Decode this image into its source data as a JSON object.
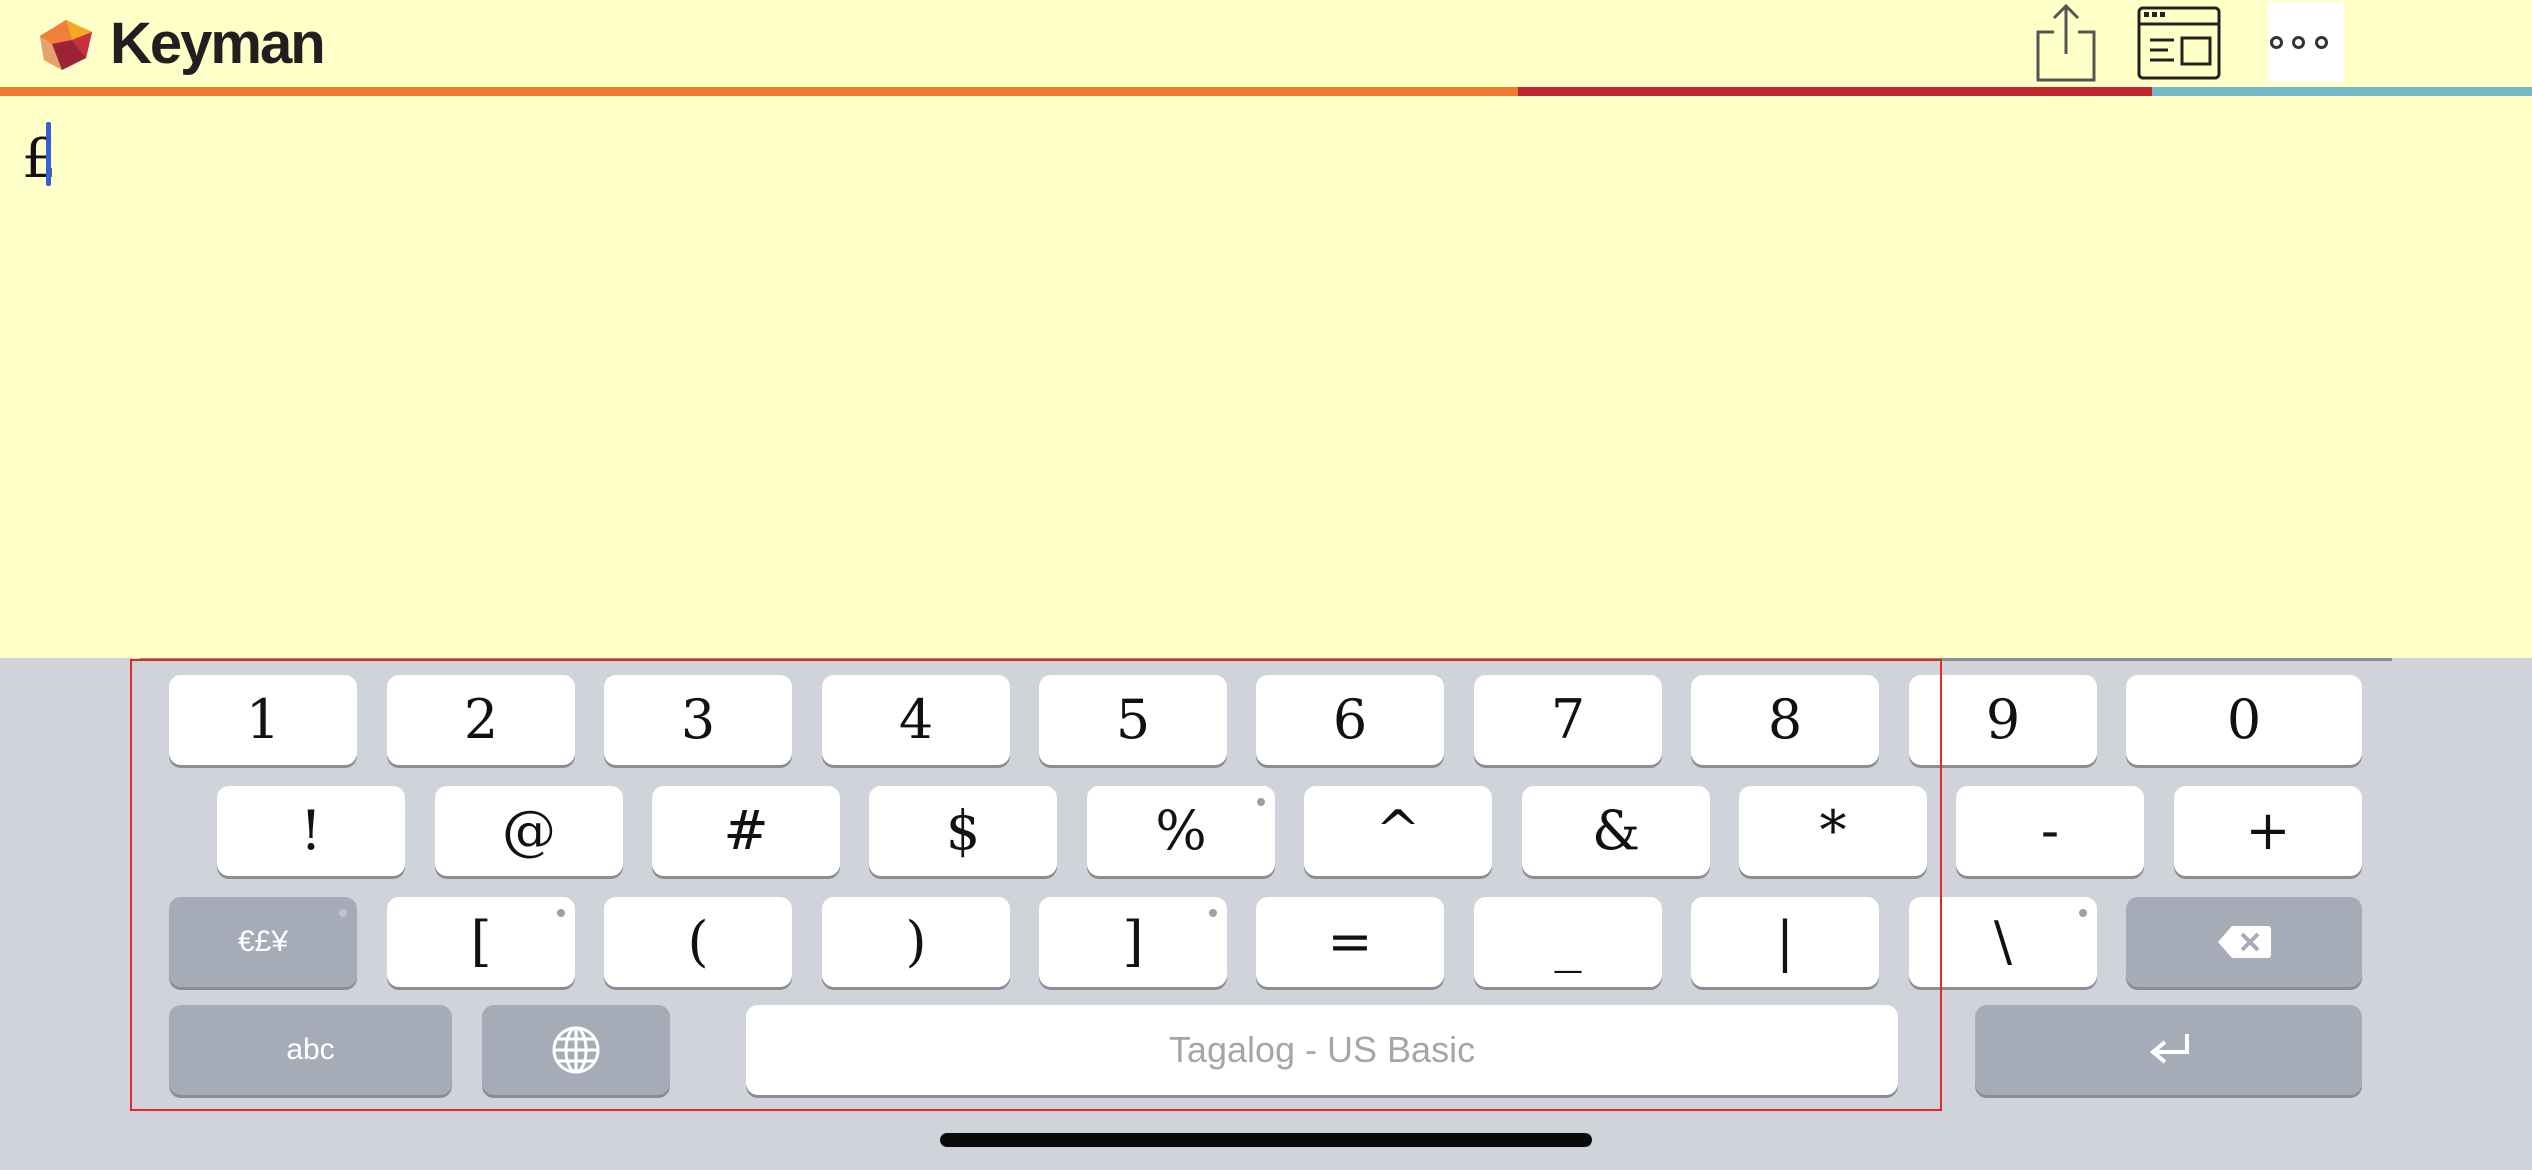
{
  "app": {
    "brand": "Keyman"
  },
  "toolbar": {
    "share_icon": "share-icon",
    "keyboard_picker_icon": "keyboard-picker-icon",
    "more_icon": "more-icon"
  },
  "stripe_colors": {
    "orange": "#ef7a31",
    "red": "#c0262d",
    "teal": "#74b9c8"
  },
  "editor": {
    "text": "£"
  },
  "keyboard": {
    "name": "Tagalog - US Basic",
    "row1": [
      "1",
      "2",
      "3",
      "4",
      "5",
      "6",
      "7",
      "8",
      "9",
      "0"
    ],
    "row2": [
      "!",
      "@",
      "#",
      "$",
      "%",
      "^",
      "&",
      "*",
      "-",
      "+"
    ],
    "row3": [
      "€£¥",
      "[",
      "(",
      ")",
      "]",
      "=",
      "_",
      "|",
      "\\"
    ],
    "keys": {
      "abc": "abc",
      "globe_icon": "globe-icon",
      "backspace_icon": "backspace-icon",
      "enter_icon": "enter-icon"
    },
    "colors": {
      "key": "#ffffff",
      "dark_key": "#a6acb7",
      "background": "#d0d3da"
    }
  }
}
